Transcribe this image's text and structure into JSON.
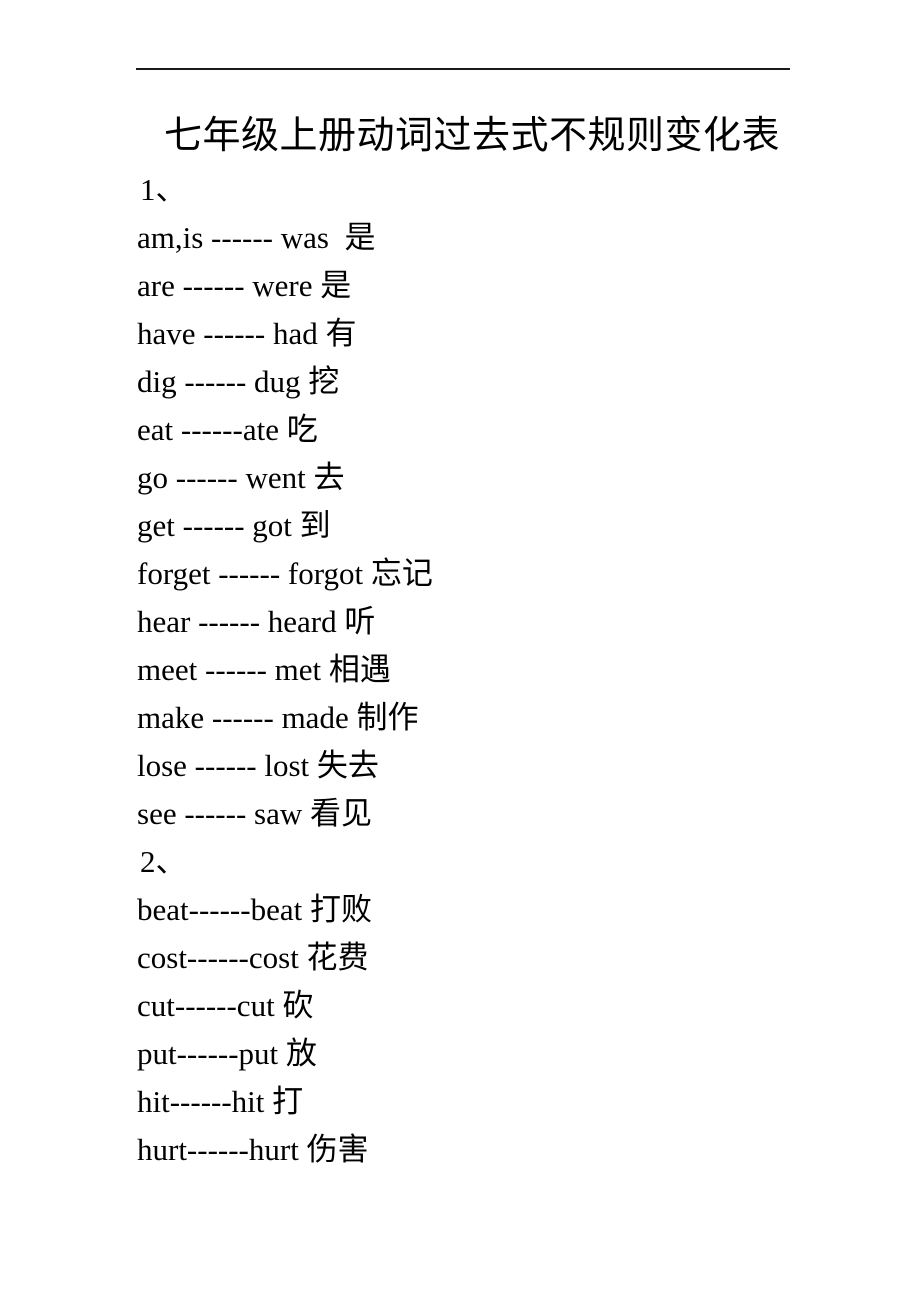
{
  "document": {
    "title": "七年级上册动词过去式不规则变化表",
    "header_rule": true,
    "sections": [
      {
        "label": "1、",
        "entries": [
          {
            "line": "am,is ------ was  是",
            "base": "am,is",
            "past": "was",
            "meaning": "是"
          },
          {
            "line": "are ------ were 是",
            "base": "are",
            "past": "were",
            "meaning": "是"
          },
          {
            "line": "have ------ had 有",
            "base": "have",
            "past": "had",
            "meaning": "有"
          },
          {
            "line": "dig ------ dug 挖",
            "base": "dig",
            "past": "dug",
            "meaning": "挖"
          },
          {
            "line": "eat ------ate 吃",
            "base": "eat",
            "past": "ate",
            "meaning": "吃"
          },
          {
            "line": "go ------ went 去",
            "base": "go",
            "past": "went",
            "meaning": "去"
          },
          {
            "line": "get ------ got 到",
            "base": "get",
            "past": "got",
            "meaning": "到"
          },
          {
            "line": "forget ------ forgot 忘记",
            "base": "forget",
            "past": "forgot",
            "meaning": "忘记"
          },
          {
            "line": "hear ------ heard 听",
            "base": "hear",
            "past": "heard",
            "meaning": "听"
          },
          {
            "line": "meet ------ met 相遇",
            "base": "meet",
            "past": "met",
            "meaning": "相遇"
          },
          {
            "line": "make ------ made 制作",
            "base": "make",
            "past": "made",
            "meaning": "制作"
          },
          {
            "line": "lose ------ lost 失去",
            "base": "lose",
            "past": "lost",
            "meaning": "失去"
          },
          {
            "line": "see ------ saw 看见",
            "base": "see",
            "past": "saw",
            "meaning": "看见"
          }
        ]
      },
      {
        "label": "2、",
        "entries": [
          {
            "line": "beat------beat 打败",
            "base": "beat",
            "past": "beat",
            "meaning": "打败"
          },
          {
            "line": "cost------cost 花费",
            "base": "cost",
            "past": "cost",
            "meaning": "花费"
          },
          {
            "line": "cut------cut 砍",
            "base": "cut",
            "past": "cut",
            "meaning": "砍"
          },
          {
            "line": "put------put 放",
            "base": "put",
            "past": "put",
            "meaning": "放"
          },
          {
            "line": "hit------hit 打",
            "base": "hit",
            "past": "hit",
            "meaning": "打"
          },
          {
            "line": "hurt------hurt 伤害",
            "base": "hurt",
            "past": "hurt",
            "meaning": "伤害"
          }
        ]
      }
    ]
  },
  "lines": [
    "1、",
    "am,is ------ was  是",
    "are ------ were 是",
    "have ------ had 有",
    "dig ------ dug 挖",
    "eat ------ate 吃",
    "go ------ went 去",
    "get ------ got 到",
    "forget ------ forgot 忘记",
    "hear ------ heard 听",
    "meet ------ met 相遇",
    "make ------ made 制作",
    "lose ------ lost 失去",
    "see ------ saw 看见",
    "2、",
    "beat------beat 打败",
    "cost------cost 花费",
    "cut------cut 砍",
    "put------put 放",
    "hit------hit 打",
    "hurt------hurt 伤害"
  ]
}
